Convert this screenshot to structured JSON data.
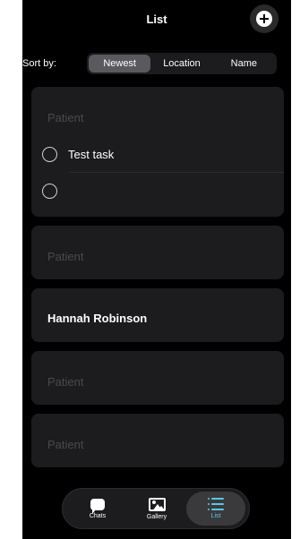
{
  "header": {
    "title": "List",
    "add_icon": "plus-circle-icon"
  },
  "sort": {
    "label": "Sort by:",
    "options": [
      "Newest",
      "Location",
      "Name"
    ],
    "selected": "Newest"
  },
  "cards": [
    {
      "label": "Patient",
      "tasks": [
        {
          "text": "Test task",
          "done": false
        },
        {
          "text": "",
          "done": false
        }
      ]
    },
    {
      "label": "Patient"
    },
    {
      "label": "Hannah  Robinson"
    },
    {
      "label": "Patient"
    },
    {
      "label": "Patient"
    }
  ],
  "tabbar": {
    "items": [
      {
        "label": "Chats",
        "icon": "chat-bubble-icon"
      },
      {
        "label": "Gallery",
        "icon": "image-icon"
      },
      {
        "label": "List",
        "icon": "list-icon"
      }
    ],
    "active": "List",
    "accent_color": "#5ac8e6"
  }
}
